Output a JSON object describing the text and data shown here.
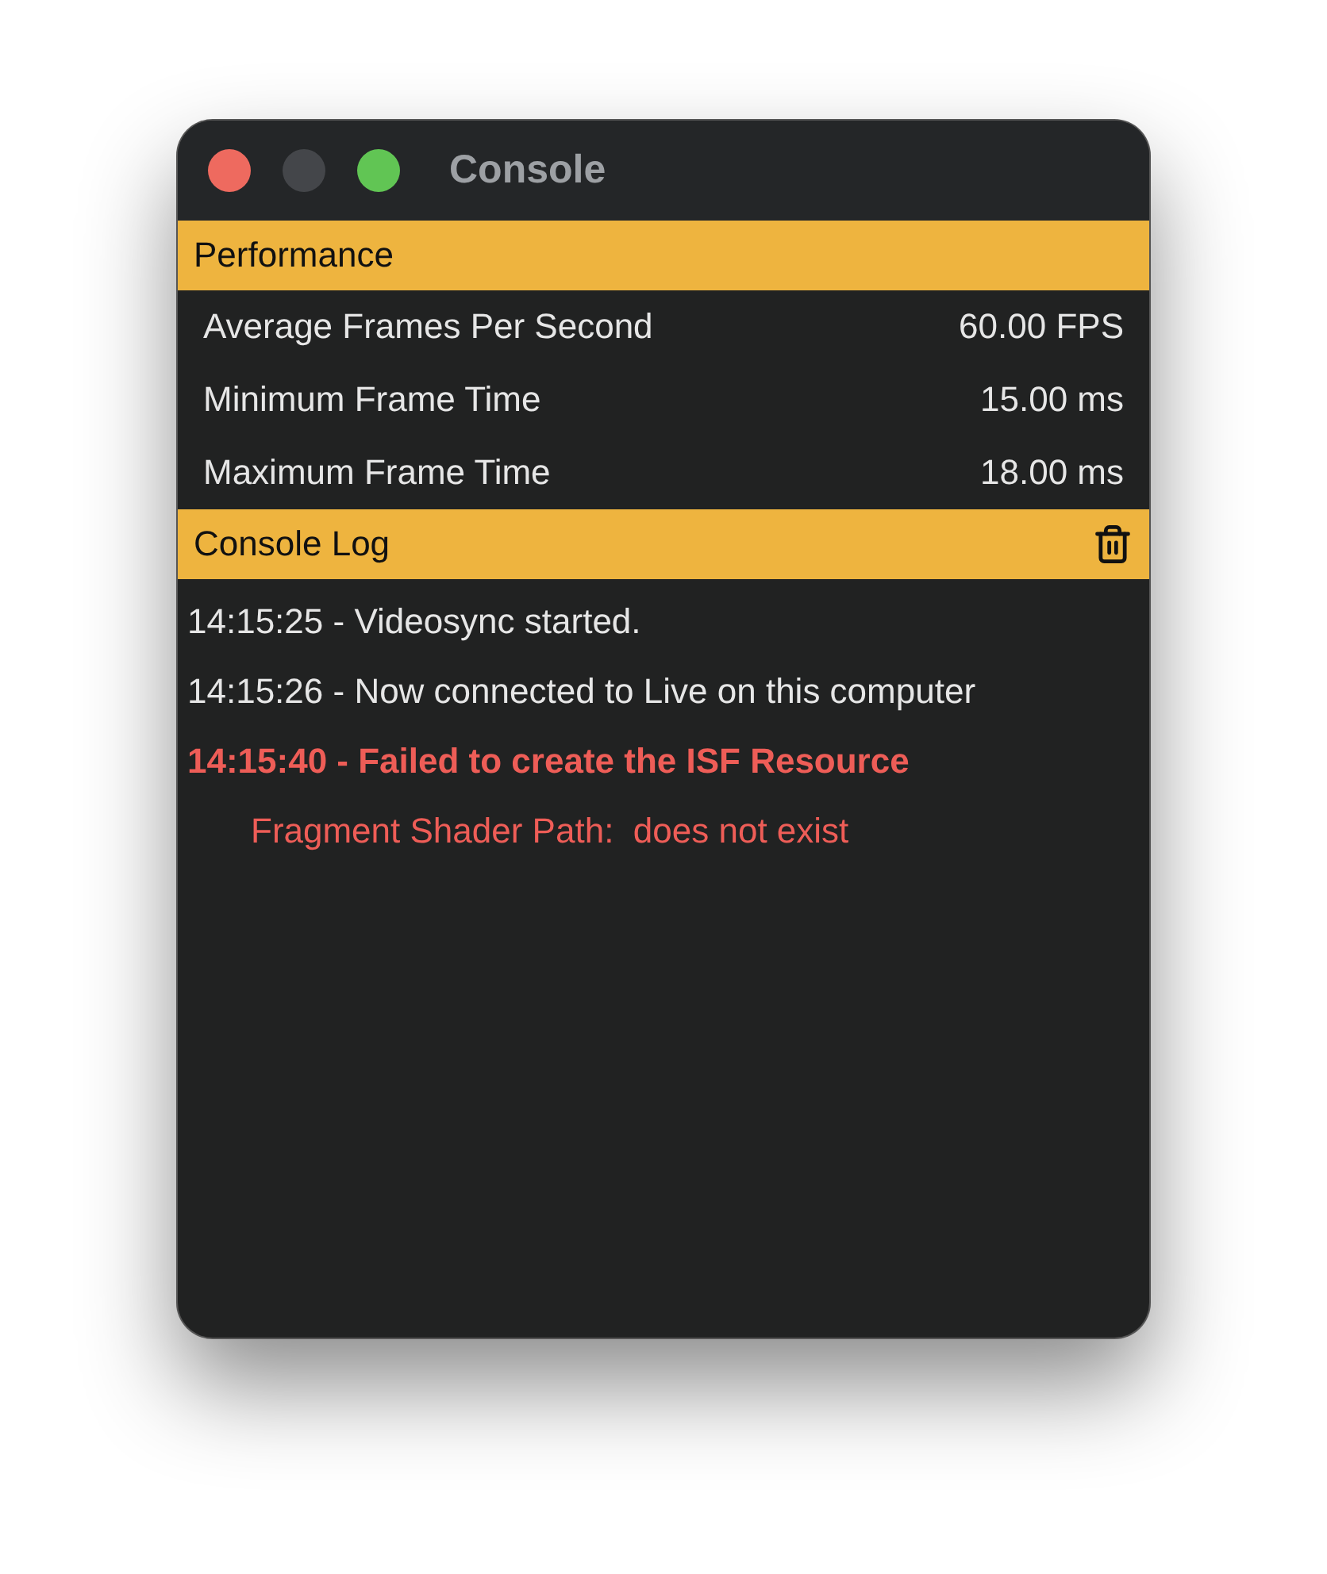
{
  "window": {
    "title": "Console",
    "traffic_lights": [
      {
        "kind": "close",
        "disabled": false
      },
      {
        "kind": "minimize",
        "disabled": true
      },
      {
        "kind": "zoom",
        "disabled": false
      }
    ]
  },
  "performance": {
    "title": "Performance",
    "rows": [
      {
        "label": "Average Frames Per Second",
        "value": "60.00 FPS"
      },
      {
        "label": "Minimum Frame Time",
        "value": "15.00 ms"
      },
      {
        "label": "Maximum Frame Time",
        "value": "18.00 ms"
      }
    ]
  },
  "console_log": {
    "title": "Console Log",
    "lines": [
      {
        "kind": "entry",
        "error": false,
        "text": "14:15:25 - Videosync started."
      },
      {
        "kind": "entry",
        "error": false,
        "text": "14:15:26 - Now connected to Live on this computer"
      },
      {
        "kind": "entry",
        "error": true,
        "text": "14:15:40 - Failed to create the ISF Resource"
      },
      {
        "kind": "detail",
        "error": true,
        "text": "Fragment Shader Path:  does not exist"
      }
    ]
  }
}
